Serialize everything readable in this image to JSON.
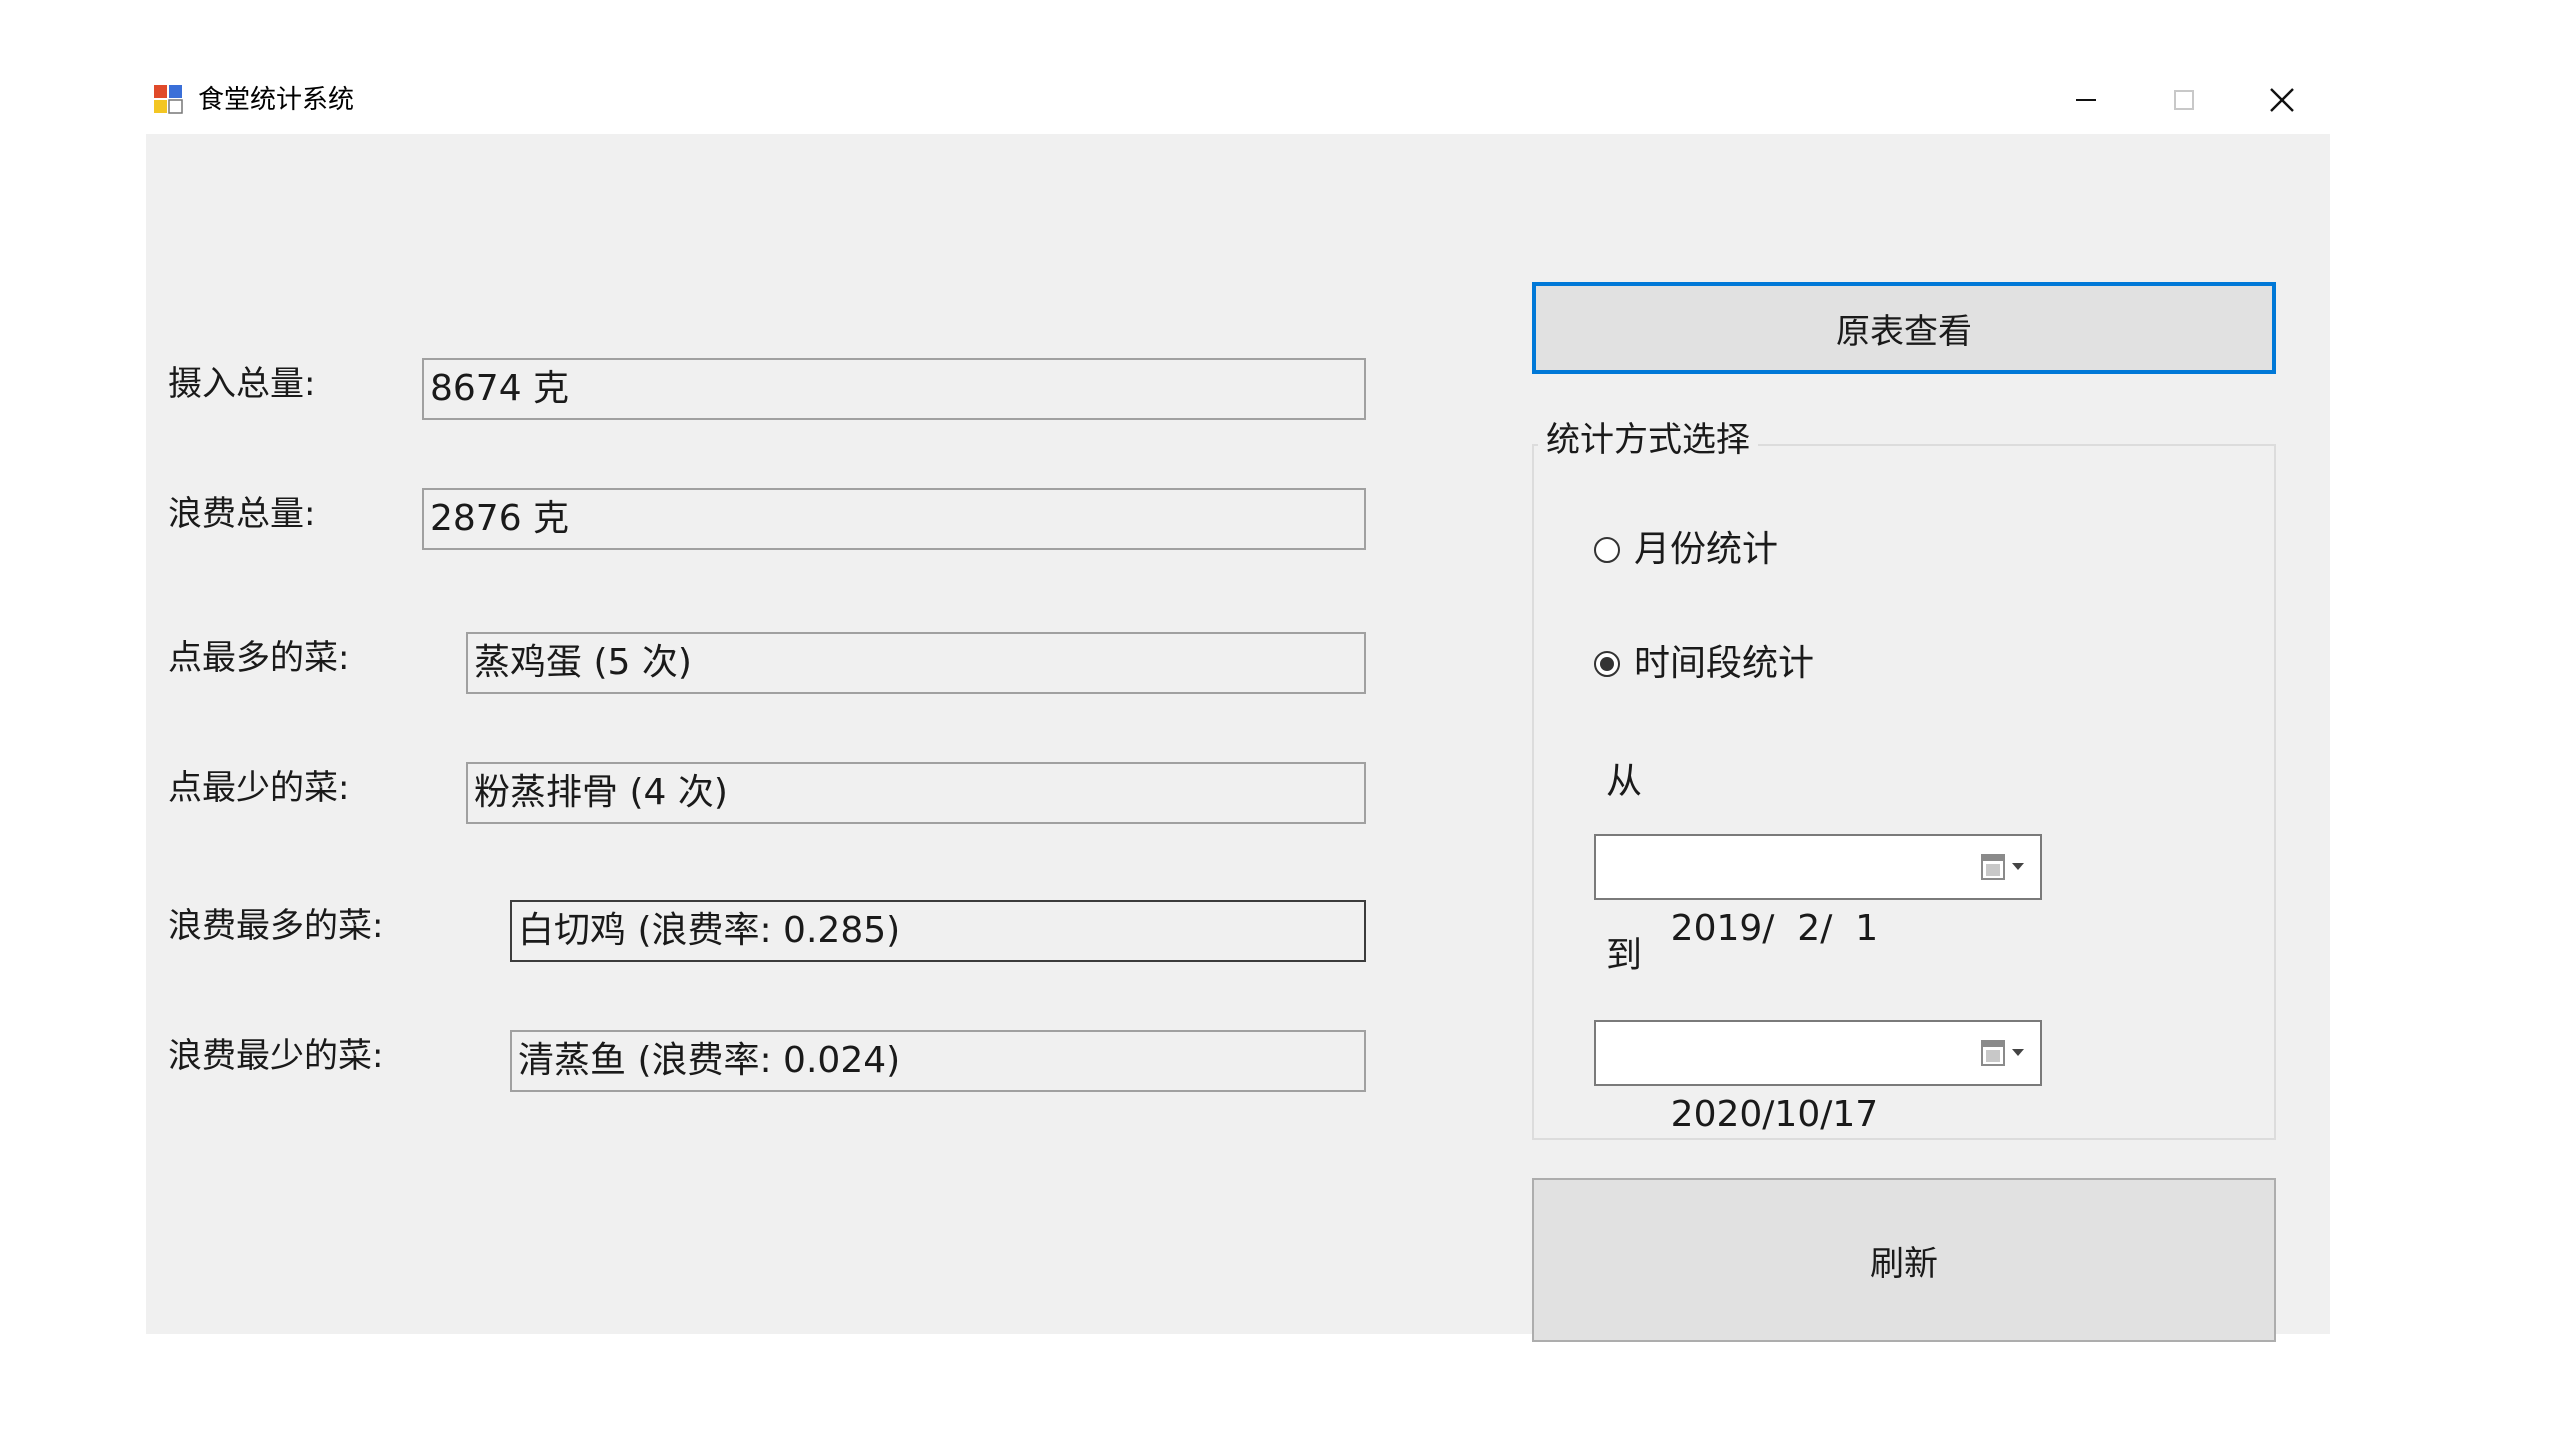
{
  "window": {
    "title": "食堂统计系统"
  },
  "colors": {
    "accent": "#0078d7",
    "client_background": "#f0f0f0",
    "button_face": "#e1e1e1"
  },
  "icons": {
    "app": "app-icon",
    "minimize": "minimize-icon",
    "maximize": "maximize-icon",
    "close": "close-icon",
    "calendar": "calendar-dropdown-icon"
  },
  "stats": {
    "intake_label": "摄入总量:",
    "intake_value": "8674 克",
    "waste_label": "浪费总量:",
    "waste_value": "2876 克",
    "most_ordered_label": "点最多的菜:",
    "most_ordered_value": "蒸鸡蛋 (5 次)",
    "least_ordered_label": "点最少的菜:",
    "least_ordered_value": "粉蒸排骨 (4 次)",
    "most_wasted_label": "浪费最多的菜:",
    "most_wasted_value": "白切鸡 (浪费率: 0.285)",
    "least_wasted_label": "浪费最少的菜:",
    "least_wasted_value": "清蒸鱼 (浪费率: 0.024)"
  },
  "buttons": {
    "view_original": "原表查看",
    "refresh": "刷新"
  },
  "mode_group": {
    "title": "统计方式选择",
    "options": [
      {
        "label": "月份统计",
        "selected": false
      },
      {
        "label": "时间段统计",
        "selected": true
      }
    ],
    "from_label": "从",
    "from_date": "2019/  2/  1",
    "to_label": "到",
    "to_date": "2020/10/17"
  }
}
